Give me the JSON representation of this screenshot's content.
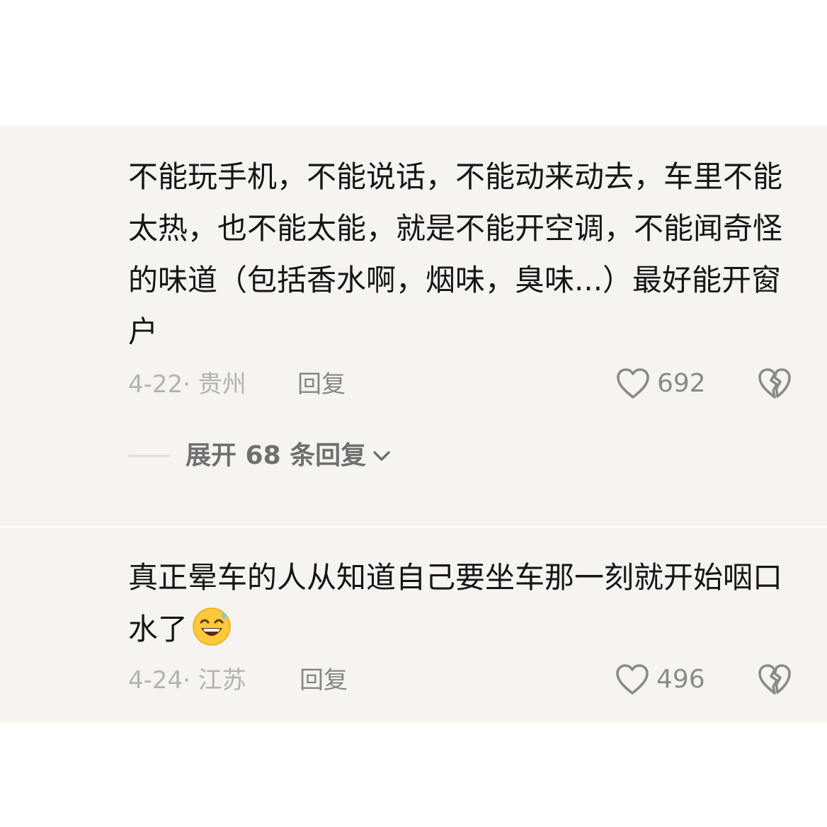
{
  "comments": [
    {
      "text": "不能玩手机，不能说话，不能动来动去，车里不能太热，也不能太能，就是不能开空调，不能闻奇怪的味道（包括香水啊，烟味，臭味...）最好能开窗户",
      "date_location": "4-22· 贵州",
      "reply_label": "回复",
      "likes": "692",
      "like_icon": "heart-outline-icon",
      "dislike_icon": "broken-heart-icon",
      "expand_label": "展开 68 条回复",
      "expand_icon": "chevron-down-icon"
    },
    {
      "text": "真正晕车的人从知道自己要坐车那一刻就开始咽口水了",
      "emoji": "grinning-sweat-emoji",
      "date_location": "4-24· 江苏",
      "reply_label": "回复",
      "likes": "496",
      "like_icon": "heart-outline-icon",
      "dislike_icon": "broken-heart-icon"
    }
  ],
  "colors": {
    "band_background": "#f5f4f1",
    "text": "#161616",
    "meta_text": "#b2b2b2",
    "icon_gray": "#8a8a8a",
    "emoji_yellow": "#ffc93a"
  }
}
